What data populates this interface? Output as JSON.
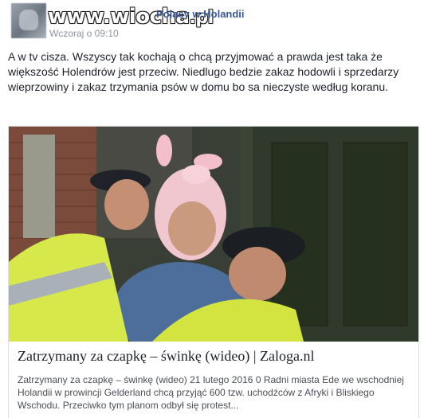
{
  "post": {
    "author": "Polacy w Holandii",
    "timestamp": "Wczoraj o 09:10",
    "watermark_main": "www.wiocha",
    "watermark_tld": ".pl",
    "text": "A w tv cisza. Wszyscy tak kochają o chcą przyjmować a prawda jest taka że większość Holendrów jest przeciw. Niedlugo bedzie zakaz hodowli i sprzedarzy wieprzowiny i zakaz trzymania psów w domu bo sa nieczyste według koranu."
  },
  "link_card": {
    "title": "Zatrzymany za czapkę – świnkę (wideo) | Zaloga.nl",
    "description": "Zatrzymany za czapkę – świnkę (wideo) 21 lutego 2016 0 Radni miasta Ede we wschodniej Holandii w prowincji Gelderland chcą przyjąć 600 tzw. uchodźców z Afryki i Bliskiego Wschodu. Przeciwko tym planom odbył się protest...",
    "image": "photo of police officers detaining a man wearing a pink pig hat"
  },
  "colors": {
    "author_link": "#365899",
    "timestamp": "#90949c",
    "body_text": "#1d2129",
    "description_text": "#4b4f56",
    "card_border": "#dddfe2"
  }
}
